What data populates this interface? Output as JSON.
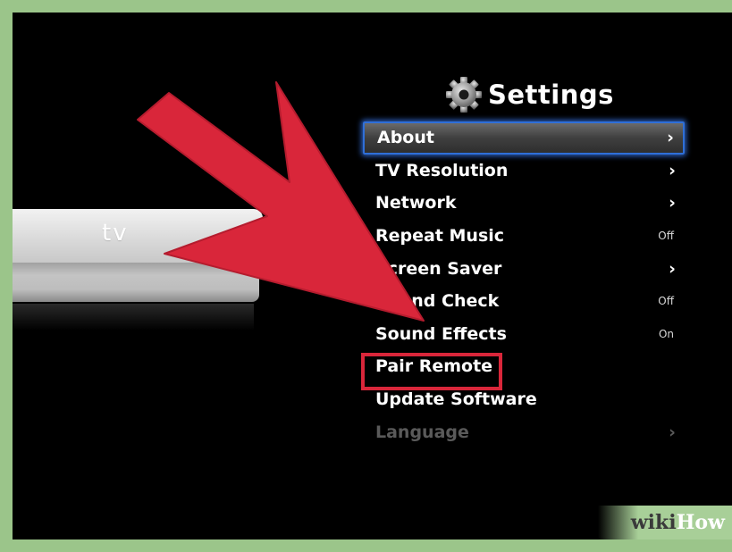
{
  "header": {
    "title": "Settings",
    "icon": "gear-icon"
  },
  "device": {
    "logo": " tv"
  },
  "menu": {
    "items": [
      {
        "label": "About",
        "indicator": "›",
        "selected": true
      },
      {
        "label": "TV Resolution",
        "indicator": "›"
      },
      {
        "label": "Network",
        "indicator": "›"
      },
      {
        "label": "Repeat Music",
        "value": "Off"
      },
      {
        "label": "Screen Saver",
        "indicator": "›"
      },
      {
        "label": "Sound Check",
        "value": "Off"
      },
      {
        "label": "Sound Effects",
        "value": "On"
      },
      {
        "label": "Pair Remote",
        "highlighted": true
      },
      {
        "label": "Update Software"
      },
      {
        "label": "Language",
        "indicator": "›",
        "disabled": true
      }
    ]
  },
  "watermark": {
    "wiki": "wiki",
    "how": "How"
  },
  "colors": {
    "arrow": "#d9263a",
    "selection_glow": "#2f6fd8",
    "background": "#000000",
    "frame": "#9bc58a"
  }
}
